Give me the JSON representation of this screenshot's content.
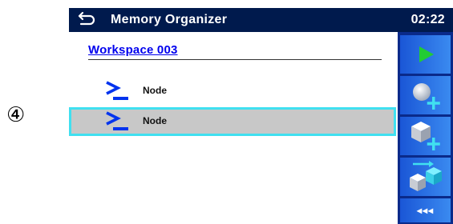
{
  "annotation": {
    "marker": "④"
  },
  "header": {
    "title": "Memory Organizer",
    "clock": "02:22",
    "back_icon": "return-arrow-icon"
  },
  "workspace": {
    "label": "Workspace 003"
  },
  "tree": {
    "nodes": [
      {
        "label": "Node",
        "icon": "node-prompt-icon",
        "selected": false
      },
      {
        "label": "Node",
        "icon": "node-prompt-icon",
        "selected": true
      }
    ]
  },
  "sidebar": {
    "buttons": [
      {
        "icon": "play-icon"
      },
      {
        "icon": "add-sphere-icon"
      },
      {
        "icon": "add-cube-icon"
      },
      {
        "icon": "move-cubes-icon"
      },
      {
        "label": "◂◂◂",
        "icon": "collapse-icon"
      }
    ]
  },
  "colors": {
    "header_bg": "#001a4d",
    "accent_blue": "#1a56d6",
    "selection_border": "#40e0f0",
    "selection_bg": "#c8c8c8",
    "play_green": "#22cc33"
  }
}
